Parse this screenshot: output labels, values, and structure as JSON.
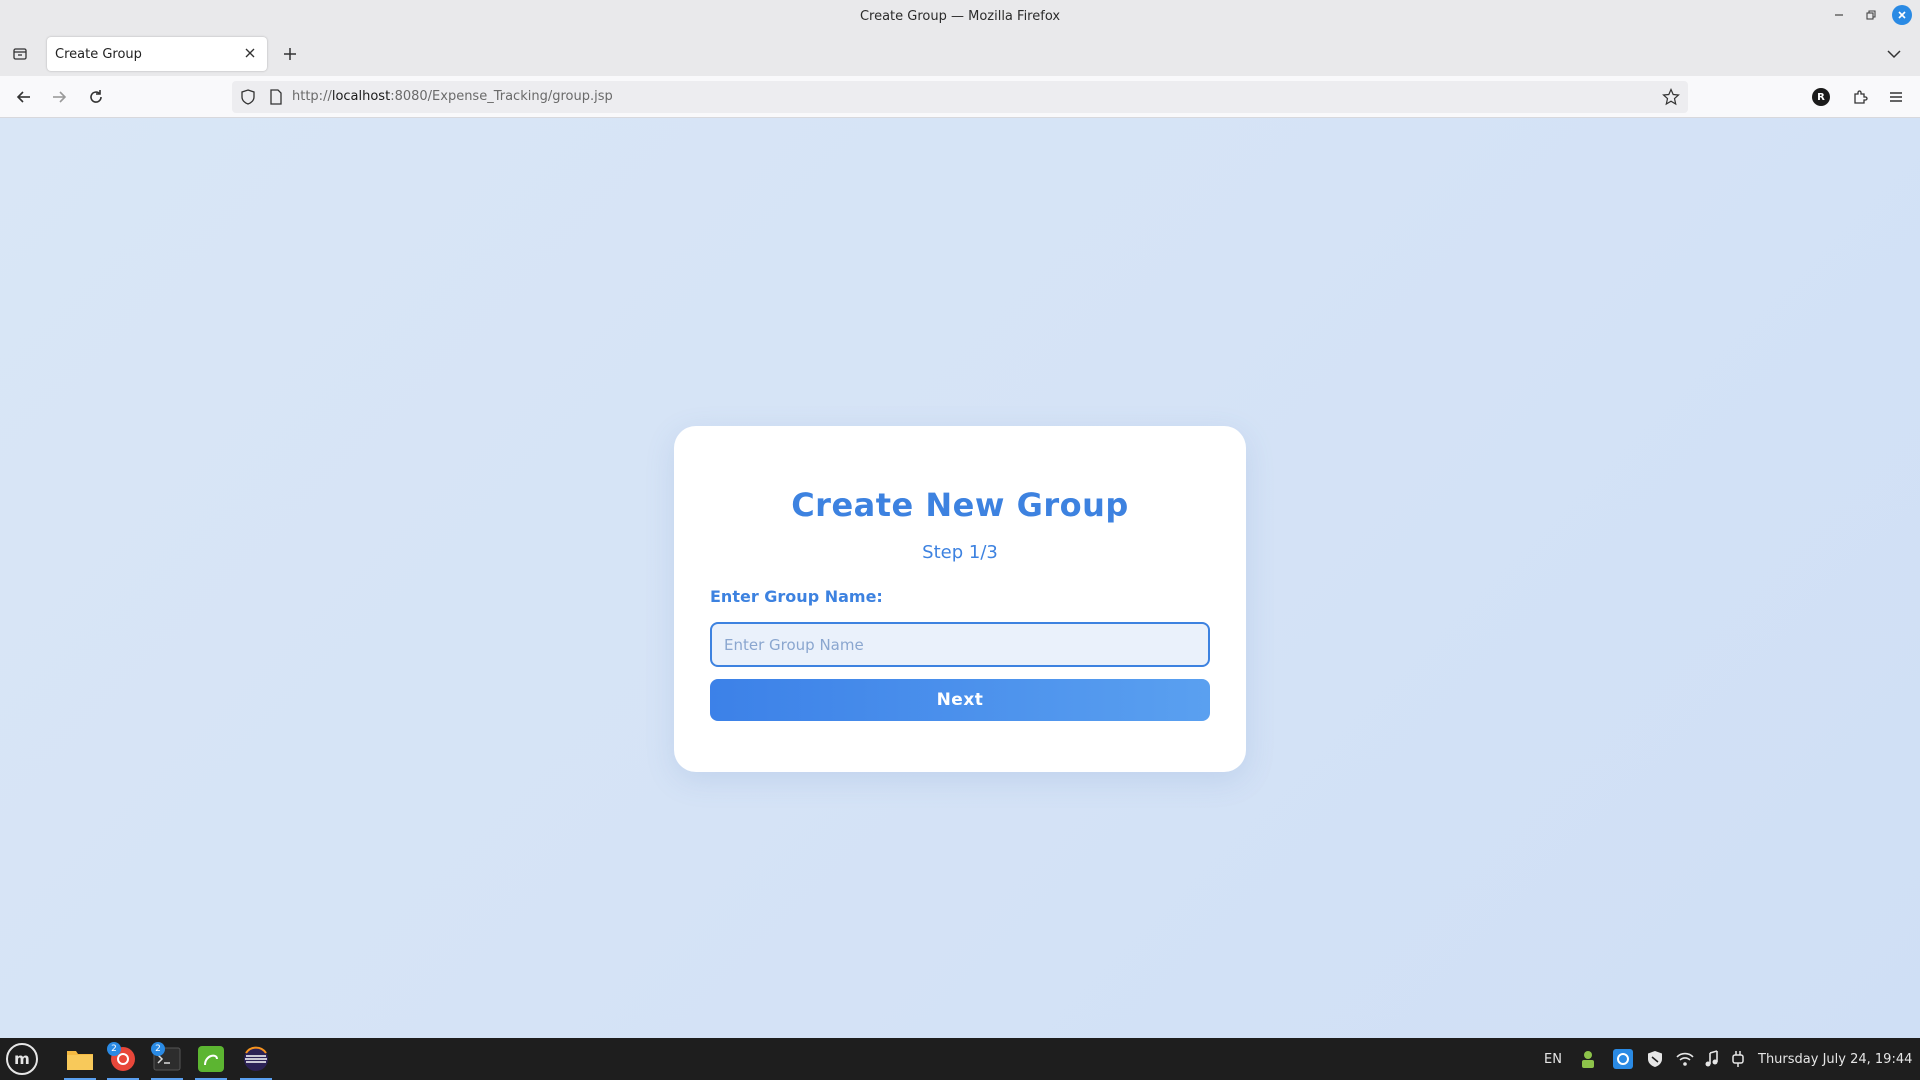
{
  "window": {
    "title": "Create Group — Mozilla Firefox"
  },
  "tabs": [
    {
      "title": "Create Group"
    }
  ],
  "navbar": {
    "url_prefix": "http://",
    "url_host": "localhost",
    "url_rest": ":8080/Expense_Tracking/group.jsp",
    "profile_initial": "R"
  },
  "card": {
    "title": "Create New Group",
    "step": "Step 1/3",
    "label": "Enter Group Name:",
    "input_placeholder": "Enter Group Name",
    "input_value": "",
    "next_label": "Next"
  },
  "taskbar": {
    "apps": [
      {
        "name": "files",
        "badge": ""
      },
      {
        "name": "browser",
        "badge": "2"
      },
      {
        "name": "terminal",
        "badge": "2"
      },
      {
        "name": "app-green",
        "badge": ""
      },
      {
        "name": "eclipse",
        "badge": ""
      }
    ],
    "language": "EN",
    "datetime": "Thursday July 24, 19:44"
  },
  "colors": {
    "accent": "#3d82e0",
    "background": "#d6e4f5",
    "taskbar": "#1e1e1e"
  }
}
